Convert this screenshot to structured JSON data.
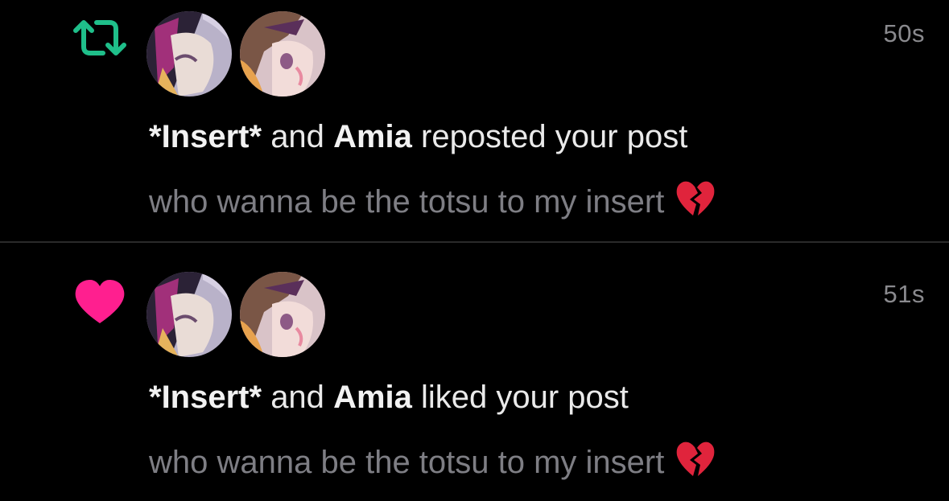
{
  "colors": {
    "background": "#000000",
    "repost_icon": "#1fbf8a",
    "like_icon": "#ff1f8f",
    "divider": "#2a2a2a",
    "muted_text": "#7e7e84"
  },
  "notifications": [
    {
      "type": "repost",
      "icon": "repost-icon",
      "timestamp": "50s",
      "actor1": "*Insert*",
      "connector": "and",
      "actor2": "Amia",
      "action": "reposted your post",
      "preview": "who wanna be the totsu to my insert",
      "preview_emoji": "broken-heart-emoji"
    },
    {
      "type": "like",
      "icon": "heart-icon",
      "timestamp": "51s",
      "actor1": "*Insert*",
      "connector": "and",
      "actor2": "Amia",
      "action": "liked your post",
      "preview": "who wanna be the totsu to my insert",
      "preview_emoji": "broken-heart-emoji"
    }
  ]
}
